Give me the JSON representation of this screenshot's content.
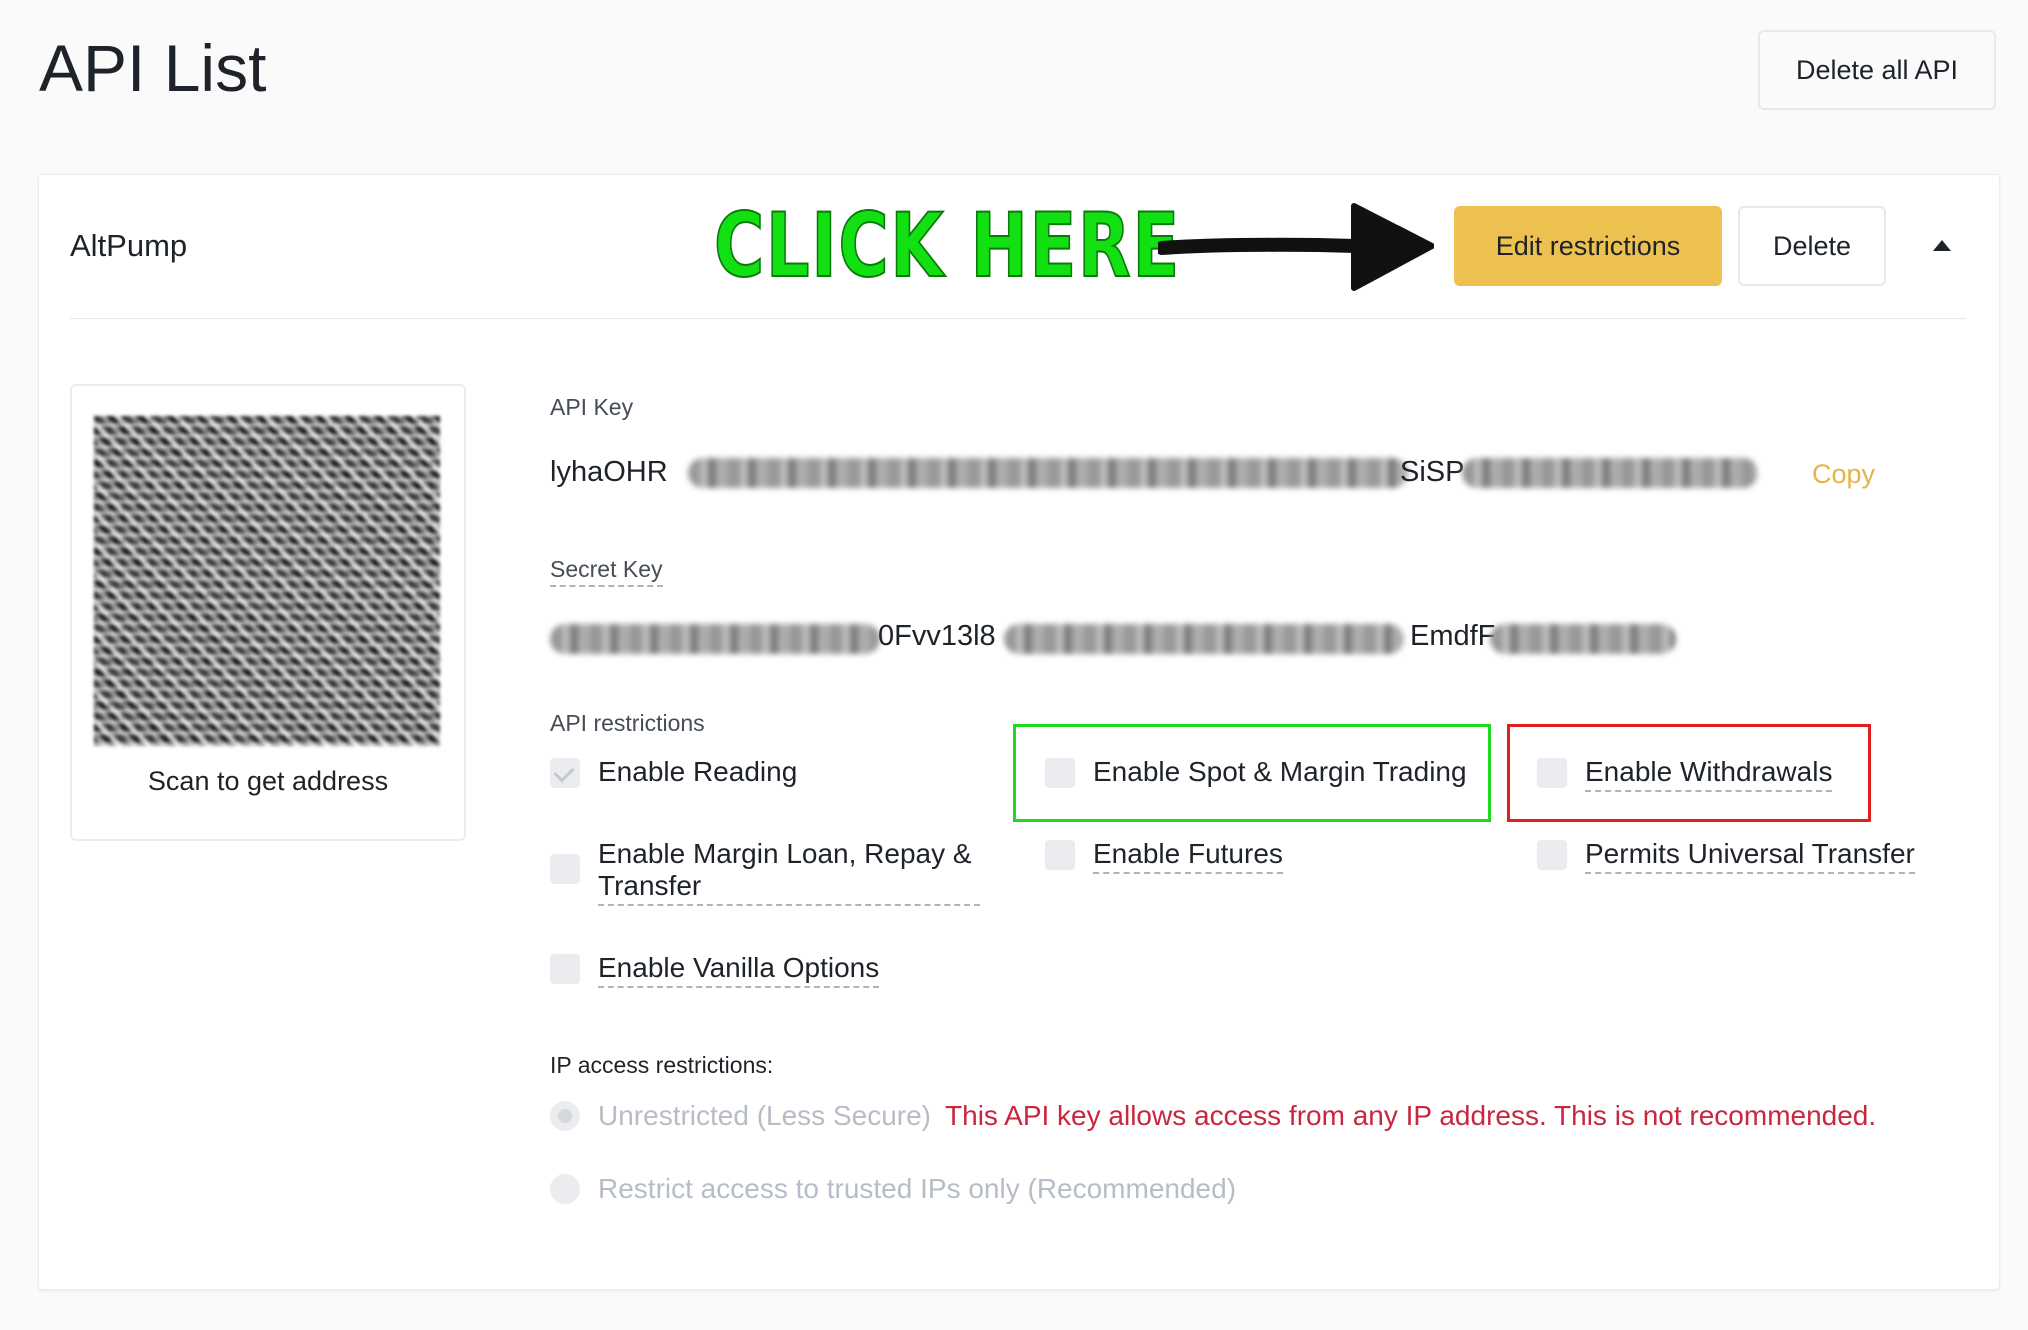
{
  "page": {
    "title": "API List",
    "delete_all_label": "Delete all API"
  },
  "api": {
    "name": "AltPump",
    "annotation": "CLICK HERE",
    "edit_label": "Edit restrictions",
    "delete_label": "Delete",
    "qr_caption": "Scan to get address",
    "api_key_label": "API Key",
    "api_key_visible_start": "lyhaOHR",
    "api_key_visible_mid": "SiSP",
    "copy_label": "Copy",
    "secret_key_label": "Secret Key",
    "secret_key_visible_mid": "0Fvv13l8",
    "secret_key_visible_end": "EmdfF",
    "restrictions_label": "API restrictions",
    "permissions": {
      "reading": {
        "label": "Enable Reading",
        "checked": true
      },
      "spot_margin": {
        "label": "Enable Spot & Margin Trading",
        "checked": false
      },
      "withdrawals": {
        "label": "Enable Withdrawals",
        "checked": false
      },
      "margin_loan": {
        "label": "Enable Margin Loan, Repay & Transfer",
        "checked": false
      },
      "futures": {
        "label": "Enable Futures",
        "checked": false
      },
      "universal_transfer": {
        "label": "Permits Universal Transfer",
        "checked": false
      },
      "vanilla_options": {
        "label": "Enable Vanilla Options",
        "checked": false
      }
    },
    "ip_label": "IP access restrictions:",
    "ip_unrestricted_label": "Unrestricted (Less Secure)",
    "ip_warning": "This API key allows access from any IP address. This is not recommended.",
    "ip_restricted_label": "Restrict access to trusted IPs only (Recommended)"
  },
  "colors": {
    "primary_button": "#ecc14f",
    "copy_link": "#e4b44a",
    "warning_text": "#c9263f",
    "annotation_green": "#12e012",
    "highlight_green": "#1ed91e",
    "highlight_red": "#e02020"
  },
  "icons": {
    "collapse": "caret-up-icon",
    "annotation_arrow": "arrow-right-icon",
    "check": "check-icon"
  }
}
